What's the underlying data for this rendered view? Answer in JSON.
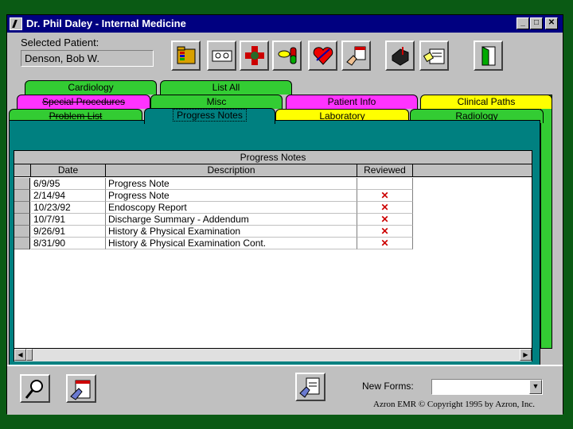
{
  "window": {
    "title": "Dr. Phil Daley - Internal Medicine"
  },
  "patient": {
    "label": "Selected Patient:",
    "name": "Denson, Bob W."
  },
  "toolbar": {
    "icons": [
      "folder-icon",
      "tape-icon",
      "doctor-cross-icon",
      "pills-icon",
      "heart-icon",
      "hand-document-icon",
      "mailbox-icon",
      "id-card-icon",
      "door-exit-icon"
    ]
  },
  "tabs": {
    "row1": [
      "Cardiology",
      "List All"
    ],
    "row2": [
      "Special Procedures",
      "Misc",
      "Patient Info",
      "Clinical Paths"
    ],
    "row3": [
      "Problem List",
      "Progress Notes",
      "Laboratory",
      "Radiology"
    ]
  },
  "grid": {
    "title": "Progress Notes",
    "columns": [
      "Date",
      "Description",
      "Reviewed"
    ],
    "rows": [
      {
        "date": "6/9/95",
        "description": "Progress Note",
        "reviewed": ""
      },
      {
        "date": "2/14/94",
        "description": "Progress Note",
        "reviewed": "✕"
      },
      {
        "date": "10/23/92",
        "description": "Endoscopy Report",
        "reviewed": "✕"
      },
      {
        "date": "10/7/91",
        "description": "Discharge Summary - Addendum",
        "reviewed": "✕"
      },
      {
        "date": "9/26/91",
        "description": "History & Physical Examination",
        "reviewed": "✕"
      },
      {
        "date": "8/31/90",
        "description": "History & Physical Examination Cont.",
        "reviewed": "✕"
      }
    ]
  },
  "bottom": {
    "new_forms_label": "New Forms:",
    "new_forms_value": "",
    "copyright": "Azron EMR © Copyright 1995 by Azron, Inc."
  },
  "colors": {
    "titlebar": "#000080",
    "panel": "#008080",
    "tab_green": "#33cc33",
    "tab_magenta": "#ff33ff",
    "tab_yellow": "#ffff00",
    "reviewed_mark": "#cc0000"
  }
}
